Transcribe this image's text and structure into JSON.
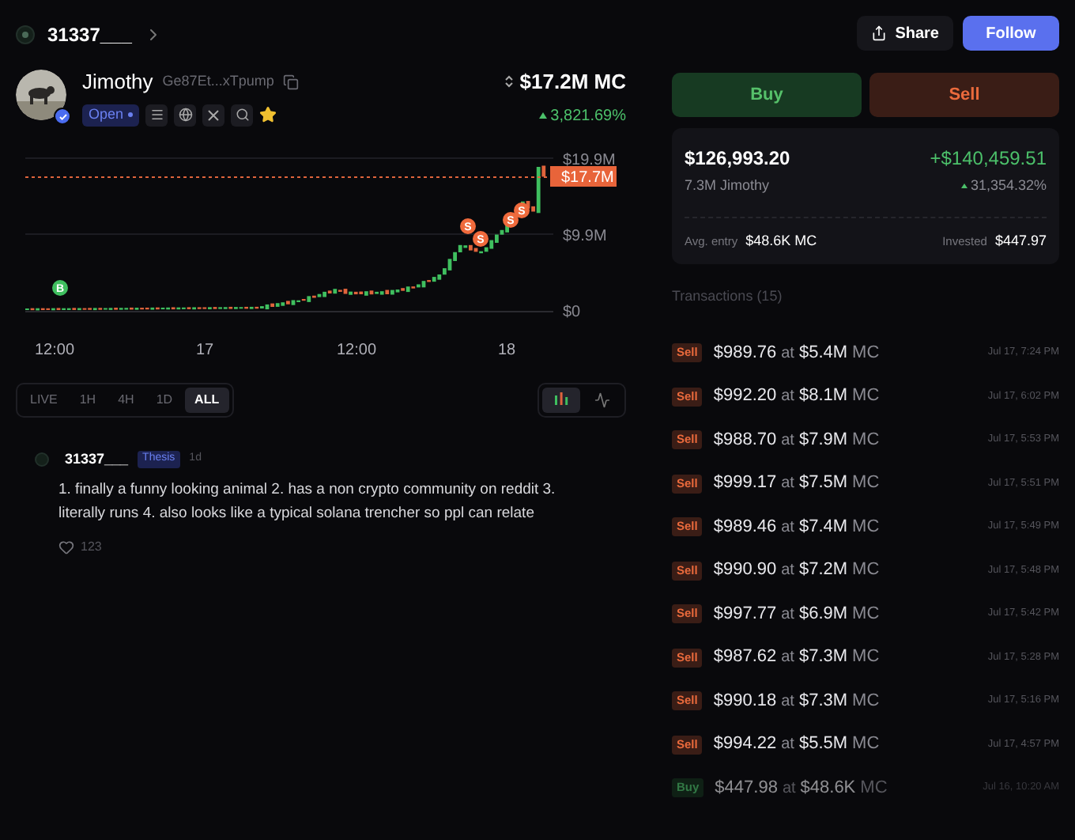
{
  "header": {
    "username": "31337___",
    "share_label": "Share",
    "follow_label": "Follow"
  },
  "token": {
    "name": "Jimothy",
    "address": "Ge87Et...xTpump",
    "status": "Open",
    "market_cap": "$17.2M MC",
    "change": "3,821.69%"
  },
  "chart": {
    "y_labels": [
      "$19.9M",
      "$9.9M",
      "$0"
    ],
    "price_tag": "$17.7M",
    "x_labels": [
      "12:00",
      "17",
      "12:00",
      "18"
    ],
    "markers": [
      {
        "kind": "buy",
        "label": "B"
      },
      {
        "kind": "sell",
        "label": "S"
      },
      {
        "kind": "sell",
        "label": "S"
      },
      {
        "kind": "sell",
        "label": "S"
      },
      {
        "kind": "sell",
        "label": "S"
      }
    ]
  },
  "ranges": [
    {
      "label": "LIVE",
      "selected": false
    },
    {
      "label": "1H",
      "selected": false
    },
    {
      "label": "4H",
      "selected": false
    },
    {
      "label": "1D",
      "selected": false
    },
    {
      "label": "ALL",
      "selected": true
    }
  ],
  "chart_modes": [
    {
      "kind": "candles",
      "selected": true
    },
    {
      "kind": "line",
      "selected": false
    }
  ],
  "comment": {
    "author": "31337___",
    "tag": "Thesis",
    "age": "1d",
    "text": "1. finally a funny looking animal 2. has a non crypto community on reddit 3. literally runs 4. also looks like a typical solana trencher so ppl can relate",
    "likes": "123"
  },
  "trade": {
    "buy_label": "Buy",
    "sell_label": "Sell"
  },
  "position": {
    "value": "$126,993.20",
    "pnl": "+$140,459.51",
    "holding": "7.3M Jimothy",
    "pnl_percent": "31,354.32%",
    "avg_entry_label": "Avg. entry",
    "avg_entry": "$48.6K MC",
    "invested_label": "Invested",
    "invested": "$447.97"
  },
  "transactions_title": "Transactions (15)",
  "transactions": [
    {
      "kind": "sell",
      "label": "Sell",
      "amount": "$989.76",
      "at": "at",
      "mc": "$5.4M",
      "unit": "MC",
      "time": "Jul 17, 7:24 PM"
    },
    {
      "kind": "sell",
      "label": "Sell",
      "amount": "$992.20",
      "at": "at",
      "mc": "$8.1M",
      "unit": "MC",
      "time": "Jul 17, 6:02 PM"
    },
    {
      "kind": "sell",
      "label": "Sell",
      "amount": "$988.70",
      "at": "at",
      "mc": "$7.9M",
      "unit": "MC",
      "time": "Jul 17, 5:53 PM"
    },
    {
      "kind": "sell",
      "label": "Sell",
      "amount": "$999.17",
      "at": "at",
      "mc": "$7.5M",
      "unit": "MC",
      "time": "Jul 17, 5:51 PM"
    },
    {
      "kind": "sell",
      "label": "Sell",
      "amount": "$989.46",
      "at": "at",
      "mc": "$7.4M",
      "unit": "MC",
      "time": "Jul 17, 5:49 PM"
    },
    {
      "kind": "sell",
      "label": "Sell",
      "amount": "$990.90",
      "at": "at",
      "mc": "$7.2M",
      "unit": "MC",
      "time": "Jul 17, 5:48 PM"
    },
    {
      "kind": "sell",
      "label": "Sell",
      "amount": "$997.77",
      "at": "at",
      "mc": "$6.9M",
      "unit": "MC",
      "time": "Jul 17, 5:42 PM"
    },
    {
      "kind": "sell",
      "label": "Sell",
      "amount": "$987.62",
      "at": "at",
      "mc": "$7.3M",
      "unit": "MC",
      "time": "Jul 17, 5:28 PM"
    },
    {
      "kind": "sell",
      "label": "Sell",
      "amount": "$990.18",
      "at": "at",
      "mc": "$7.3M",
      "unit": "MC",
      "time": "Jul 17, 5:16 PM"
    },
    {
      "kind": "sell",
      "label": "Sell",
      "amount": "$994.22",
      "at": "at",
      "mc": "$5.5M",
      "unit": "MC",
      "time": "Jul 17, 4:57 PM"
    },
    {
      "kind": "buy",
      "label": "Buy",
      "amount": "$447.98",
      "at": "at",
      "mc": "$48.6K",
      "unit": "MC",
      "time": "Jul 16, 10:20 AM"
    }
  ]
}
